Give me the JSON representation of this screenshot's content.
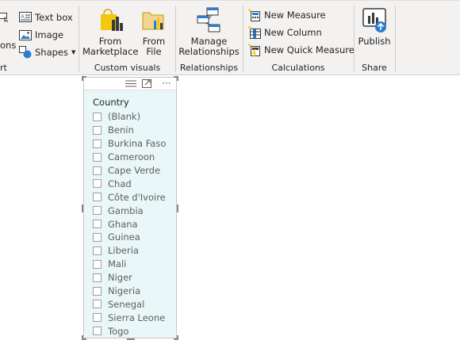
{
  "ribbon": {
    "insert_group": {
      "partial_label_top": "ons",
      "label": "rt",
      "text_box": "Text box",
      "image": "Image",
      "shapes": "Shapes"
    },
    "custom_visuals": {
      "label": "Custom visuals",
      "from_marketplace": [
        "From",
        "Marketplace"
      ],
      "from_file": [
        "From",
        "File"
      ]
    },
    "relationships": {
      "label": "Relationships",
      "manage": [
        "Manage",
        "Relationships"
      ]
    },
    "calculations": {
      "label": "Calculations",
      "new_measure": "New Measure",
      "new_column": "New Column",
      "new_quick_measure": "New Quick Measure"
    },
    "share": {
      "label": "Share",
      "publish": "Publish"
    },
    "colors": {
      "background": "#f3f2f1",
      "icon_yellow": "#f2c811",
      "icon_blue": "#2b7cd3",
      "icon_dark": "#3b3a39"
    }
  },
  "slicer": {
    "title": "Country",
    "header_icons": [
      "drag-lines-icon",
      "focus-mode-icon",
      "more-options-icon"
    ],
    "more_options_glyph": "···",
    "items": [
      "(Blank)",
      "Benin",
      "Burkina Faso",
      "Cameroon",
      "Cape Verde",
      "Chad",
      "Côte d'Ivoire",
      "Gambia",
      "Ghana",
      "Guinea",
      "Liberia",
      "Mali",
      "Niger",
      "Nigeria",
      "Senegal",
      "Sierra Leone",
      "Togo"
    ],
    "colors": {
      "background": "#e9f7f8",
      "checkbox_border": "#a19f9d"
    }
  }
}
